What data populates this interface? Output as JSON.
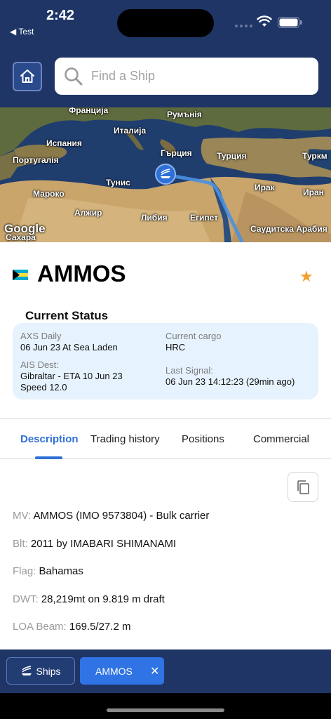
{
  "status_bar": {
    "time": "2:42",
    "back_app": "◀ Test"
  },
  "header": {
    "home_icon": "home-icon",
    "search_placeholder": "Find a Ship"
  },
  "map": {
    "labels": [
      "Франција",
      "Румънія",
      "Италија",
      "Испания",
      "Гърция",
      "Португалія",
      "Турция",
      "Туркм",
      "Тунис",
      "Ирак",
      "Иран",
      "Мароко",
      "Алжир",
      "Либия",
      "Египет",
      "Саудитска Арабия",
      "Сахара"
    ],
    "attribution": "Google",
    "marker_icon": "ship-icon"
  },
  "ship": {
    "name": "AMMOS",
    "flag_country": "Bahamas",
    "favorite_icon": "star-icon"
  },
  "current_status": {
    "title": "Current Status",
    "axs_daily_label": "AXS Daily",
    "axs_daily_value": "06 Jun 23 At Sea Laden",
    "current_cargo_label": "Current cargo",
    "current_cargo_value": "HRC",
    "ais_dest_label": "AIS Dest:",
    "ais_dest_line1": "Gibraltar - ETA 10 Jun 23",
    "ais_dest_line2": "Speed 12.0",
    "last_signal_label": "Last Signal:",
    "last_signal_value": "06 Jun 23 14:12:23 (29min ago)"
  },
  "tabs": [
    {
      "label": "Description",
      "active": true
    },
    {
      "label": "Trading history",
      "active": false
    },
    {
      "label": "Positions",
      "active": false
    },
    {
      "label": "Commercial",
      "active": false
    }
  ],
  "description": {
    "mv_key": "MV:",
    "mv_value": "AMMOS (IMO 9573804) - Bulk carrier",
    "blt_key": "Blt:",
    "blt_value": "2011 by IMABARI SHIMANAMI",
    "flag_key": "Flag:",
    "flag_value": "Bahamas",
    "dwt_key": "DWT:",
    "dwt_value": "28,219mt on 9.819 m draft",
    "loa_key": "LOA Beam:",
    "loa_value": "169.5/27.2 m",
    "copy_icon": "copy-icon"
  },
  "bottom_tabs": {
    "ships_label": "Ships",
    "open_ship_label": "AMMOS",
    "close_glyph": "✕"
  },
  "colors": {
    "header_bg": "#1f3566",
    "accent": "#2f6fd6",
    "status_card_bg": "#e6f2fd",
    "star": "#f0a030"
  }
}
